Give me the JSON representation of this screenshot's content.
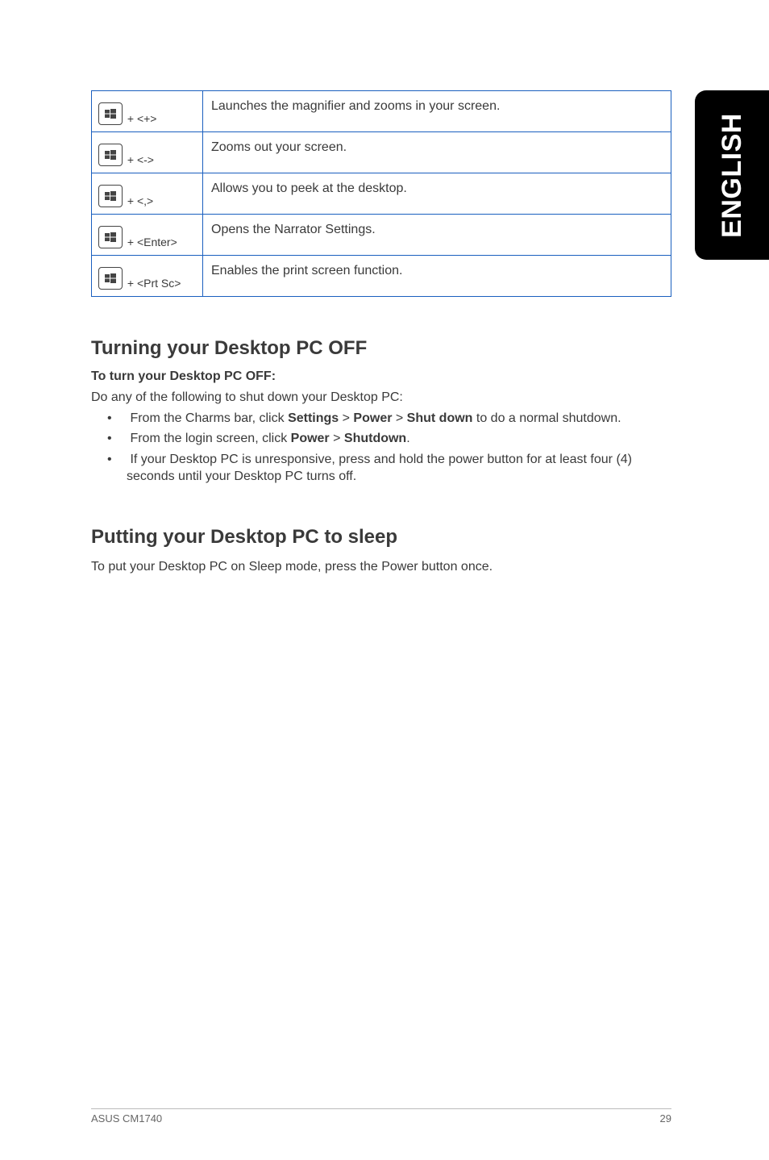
{
  "side_tab": "ENGLISH",
  "table": {
    "rows": [
      {
        "key_suffix": "+ <+>",
        "desc": "Launches the magnifier and zooms in your screen."
      },
      {
        "key_suffix": "+ <->",
        "desc": "Zooms out your screen."
      },
      {
        "key_suffix": "+ <,>",
        "desc": "Allows you to peek at the desktop."
      },
      {
        "key_suffix": "+ <Enter>",
        "desc": "Opens the Narrator Settings."
      },
      {
        "key_suffix": "+ <Prt Sc>",
        "desc": "Enables the print screen function."
      }
    ]
  },
  "section1": {
    "title": "Turning your Desktop PC OFF",
    "subhead": "To turn your Desktop PC OFF:",
    "intro": "Do any of the following to shut down your Desktop PC:",
    "bullets": [
      {
        "pre": "From the Charms bar, click ",
        "b1": "Settings",
        "sep1": " > ",
        "b2": "Power",
        "sep2": " > ",
        "b3": "Shut down",
        "post": " to do a normal shutdown."
      },
      {
        "pre": "From the login screen, click ",
        "b1": "Power",
        "sep1": " > ",
        "b2": "Shutdown",
        "post": "."
      },
      {
        "text": "If your Desktop PC is unresponsive, press and hold the power  button for at least four (4) seconds until your Desktop PC turns off."
      }
    ]
  },
  "section2": {
    "title": "Putting your Desktop PC to sleep",
    "body": "To put your Desktop PC on Sleep mode, press the Power button once."
  },
  "footer": {
    "left": "ASUS CM1740",
    "right": "29"
  }
}
